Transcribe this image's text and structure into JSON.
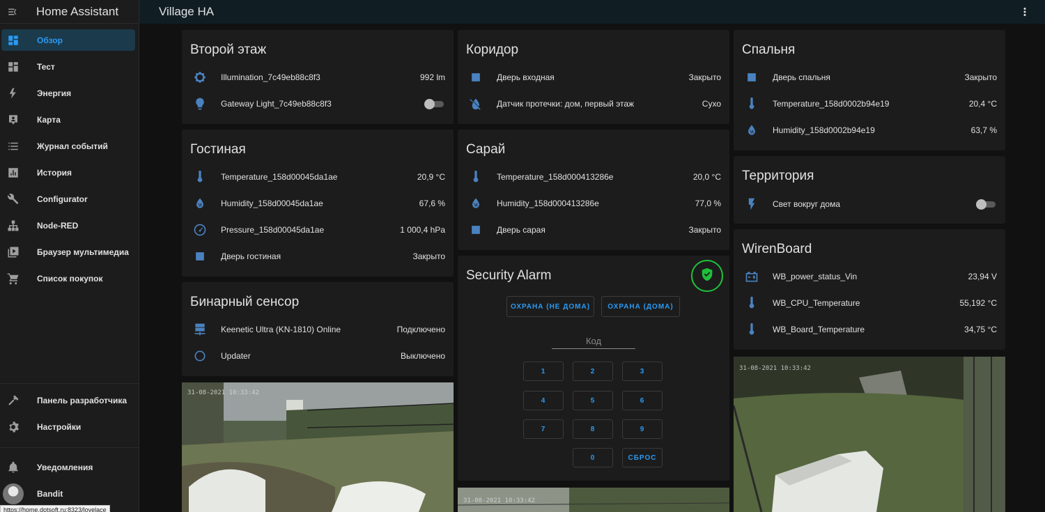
{
  "app": {
    "title": "Home Assistant",
    "dashboard_title": "Village HA",
    "status_url": "https://home.dotsoft.ru:8323/lovelace"
  },
  "colors": {
    "accent": "#2b9af3",
    "icon": "#4a82c0",
    "alarm_green": "#1fbf3a",
    "card_bg": "#1c1c1c",
    "page_bg": "#111111"
  },
  "sidebar": {
    "items": [
      {
        "label": "Обзор",
        "icon": "dashboard-icon",
        "active": true
      },
      {
        "label": "Тест",
        "icon": "view-dashboard-icon"
      },
      {
        "label": "Энергия",
        "icon": "lightning-icon"
      },
      {
        "label": "Карта",
        "icon": "map-account-icon"
      },
      {
        "label": "Журнал событий",
        "icon": "format-list-icon"
      },
      {
        "label": "История",
        "icon": "chart-box-icon"
      },
      {
        "label": "Configurator",
        "icon": "wrench-icon"
      },
      {
        "label": "Node-RED",
        "icon": "sitemap-icon"
      },
      {
        "label": "Браузер мультимедиа",
        "icon": "play-box-icon"
      },
      {
        "label": "Список покупок",
        "icon": "cart-icon"
      }
    ],
    "dev_tools": "Панель разработчика",
    "settings": "Настройки",
    "notifications": "Уведомления",
    "user": "Bandit"
  },
  "cards": {
    "floor2": {
      "title": "Второй этаж",
      "rows": [
        {
          "name": "Illumination_7c49eb88c8f3",
          "value": "992 lm",
          "icon": "brightness-icon"
        },
        {
          "name": "Gateway Light_7c49eb88c8f3",
          "icon": "lightbulb-icon",
          "toggle": "off"
        }
      ]
    },
    "living": {
      "title": "Гостиная",
      "rows": [
        {
          "name": "Temperature_158d00045da1ae",
          "value": "20,9 °C",
          "icon": "thermometer-icon"
        },
        {
          "name": "Humidity_158d00045da1ae",
          "value": "67,6 %",
          "icon": "water-percent-icon"
        },
        {
          "name": "Pressure_158d00045da1ae",
          "value": "1 000,4 hPa",
          "icon": "gauge-icon"
        },
        {
          "name": "Дверь гостиная",
          "value": "Закрыто",
          "icon": "door-closed-icon"
        }
      ]
    },
    "binary": {
      "title": "Бинарный сенсор",
      "rows": [
        {
          "name": "Keenetic Ultra (KN-1810) Online",
          "value": "Подключено",
          "icon": "server-network-icon"
        },
        {
          "name": "Updater",
          "value": "Выключено",
          "icon": "radiobox-blank-icon"
        }
      ]
    },
    "corridor": {
      "title": "Коридор",
      "rows": [
        {
          "name": "Дверь входная",
          "value": "Закрыто",
          "icon": "door-closed-icon"
        },
        {
          "name": "Датчик протечки: дом, первый этаж",
          "value": "Сухо",
          "icon": "water-off-icon"
        }
      ]
    },
    "shed": {
      "title": "Сарай",
      "rows": [
        {
          "name": "Temperature_158d000413286e",
          "value": "20,0 °C",
          "icon": "thermometer-icon"
        },
        {
          "name": "Humidity_158d000413286e",
          "value": "77,0 %",
          "icon": "water-percent-icon"
        },
        {
          "name": "Дверь сарая",
          "value": "Закрыто",
          "icon": "door-closed-icon"
        }
      ]
    },
    "alarm": {
      "title": "Security Alarm",
      "arm_away": "ОХРАНА (НЕ ДОМА)",
      "arm_home": "ОХРАНА (ДОМА)",
      "code_placeholder": "Код",
      "keys": [
        "1",
        "2",
        "3",
        "4",
        "5",
        "6",
        "7",
        "8",
        "9",
        "0",
        "СБРОС"
      ]
    },
    "bedroom": {
      "title": "Спальня",
      "rows": [
        {
          "name": "Дверь спальня",
          "value": "Закрыто",
          "icon": "door-closed-icon"
        },
        {
          "name": "Temperature_158d0002b94e19",
          "value": "20,4 °C",
          "icon": "thermometer-icon"
        },
        {
          "name": "Humidity_158d0002b94e19",
          "value": "63,7 %",
          "icon": "water-percent-icon"
        }
      ]
    },
    "territory": {
      "title": "Территория",
      "rows": [
        {
          "name": "Свет вокруг дома",
          "icon": "flash-icon",
          "toggle": "off"
        }
      ]
    },
    "wirenboard": {
      "title": "WirenBoard",
      "rows": [
        {
          "name": "WB_power_status_Vin",
          "value": "23,94 V",
          "icon": "car-battery-icon"
        },
        {
          "name": "WB_CPU_Temperature",
          "value": "55,192 °C",
          "icon": "thermometer-icon"
        },
        {
          "name": "WB_Board_Temperature",
          "value": "34,75 °C",
          "icon": "thermometer-icon"
        }
      ]
    }
  },
  "cameras": {
    "cam1_ts": "31-08-2021 10:33:42",
    "cam2_ts": "31-08-2021 10:33:42",
    "cam3_ts": "31-08-2021 10:33:42"
  }
}
